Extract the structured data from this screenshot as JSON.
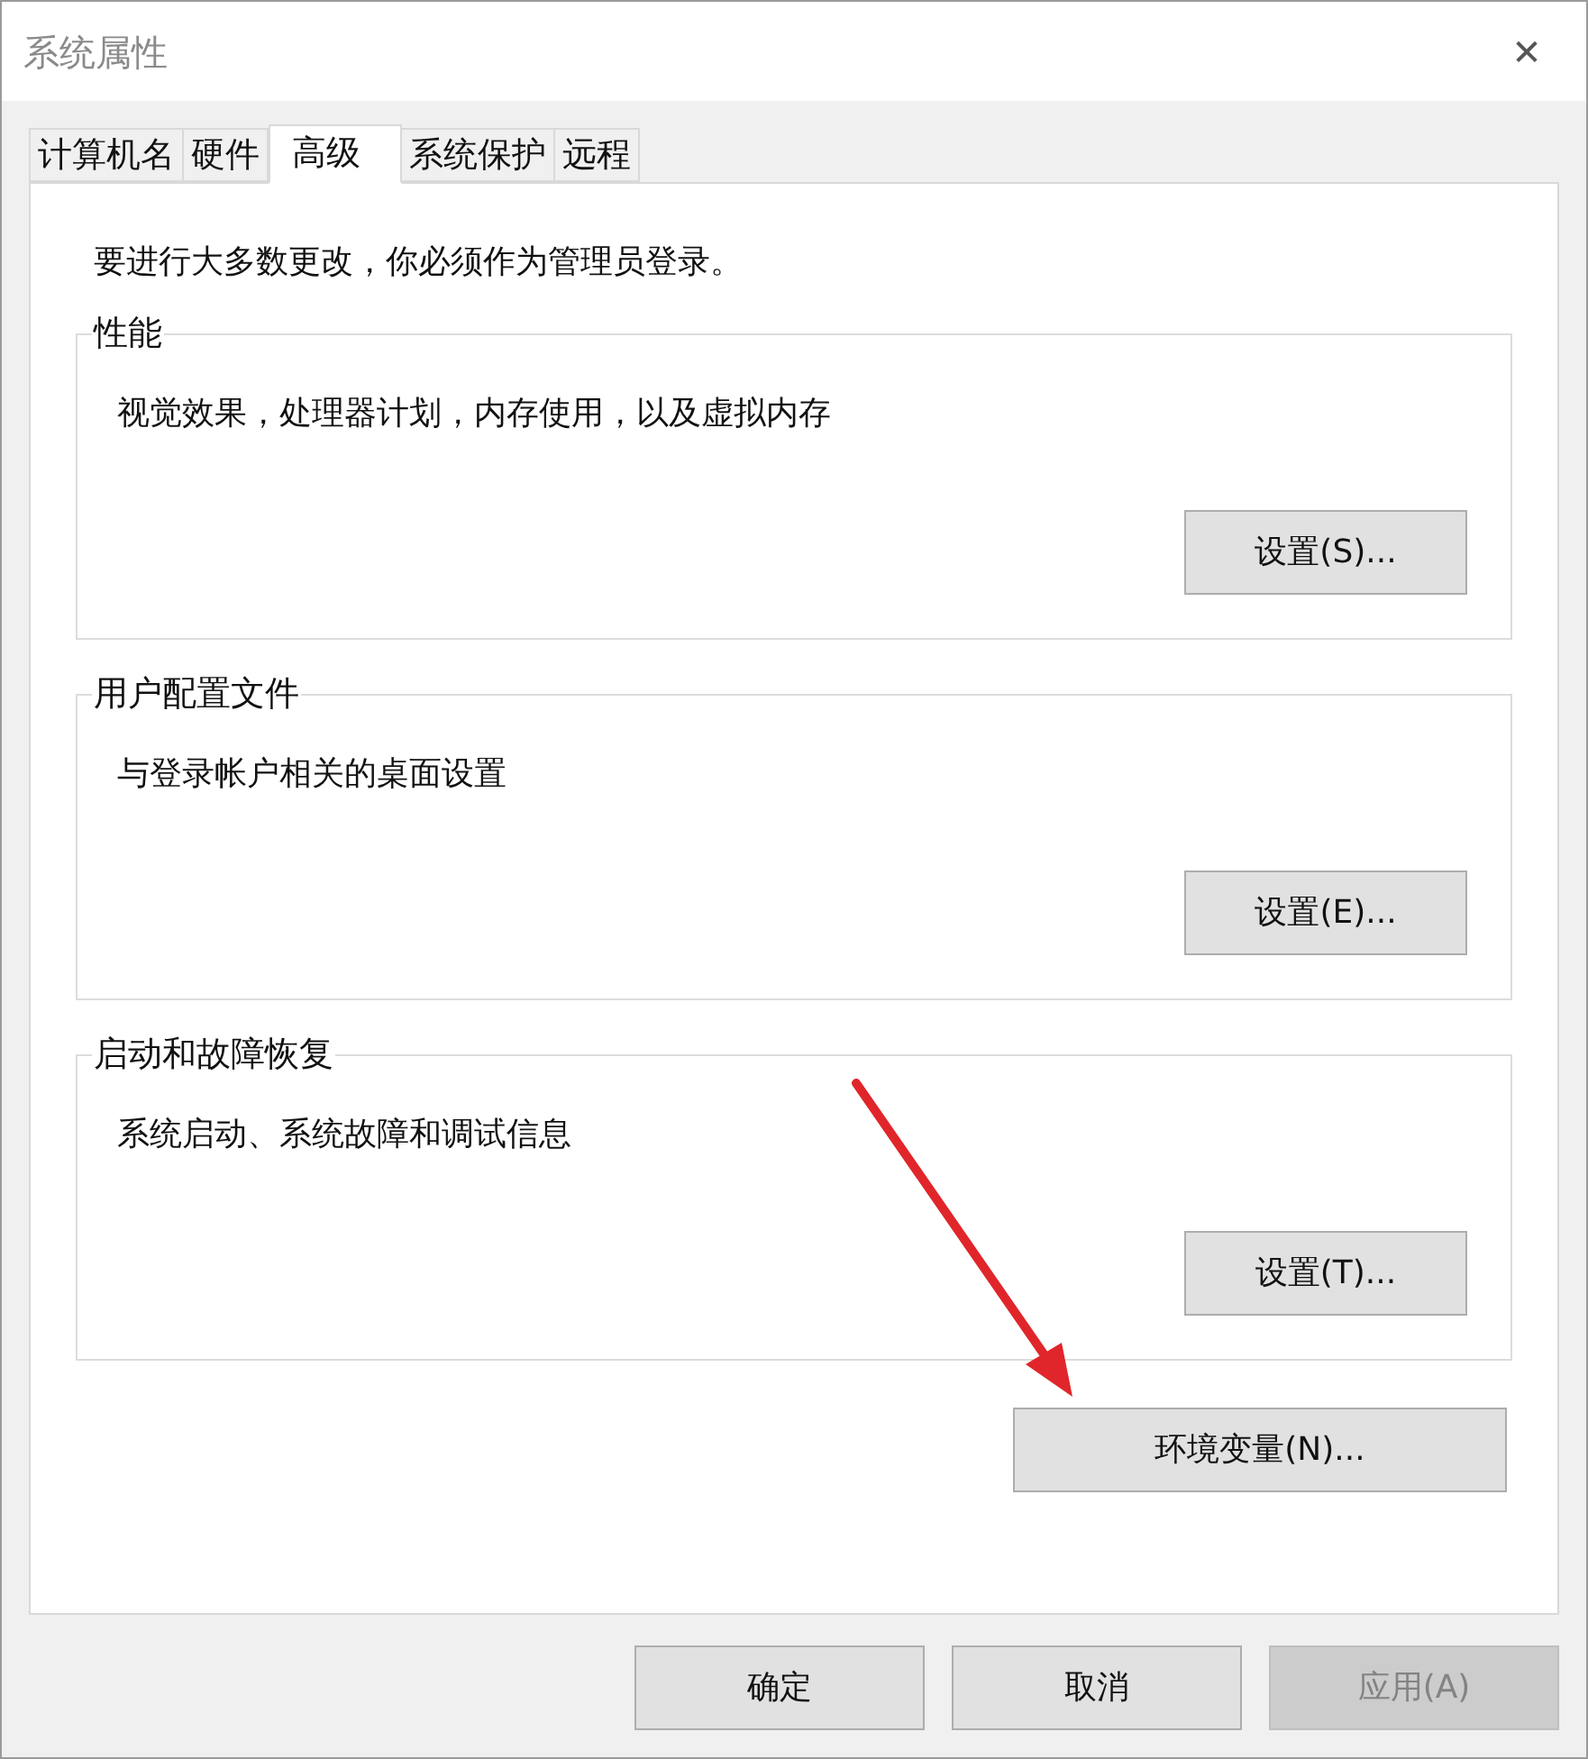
{
  "window": {
    "title": "系统属性",
    "close": "✕"
  },
  "tabs": [
    {
      "label": "计算机名",
      "selected": false
    },
    {
      "label": "硬件",
      "selected": false
    },
    {
      "label": "高级",
      "selected": true
    },
    {
      "label": "系统保护",
      "selected": false
    },
    {
      "label": "远程",
      "selected": false
    }
  ],
  "notice": "要进行大多数更改，你必须作为管理员登录。",
  "groups": [
    {
      "title": "性能",
      "description": "视觉效果，处理器计划，内存使用，以及虚拟内存",
      "button": "设置(S)..."
    },
    {
      "title": "用户配置文件",
      "description": "与登录帐户相关的桌面设置",
      "button": "设置(E)..."
    },
    {
      "title": "启动和故障恢复",
      "description": "系统启动、系统故障和调试信息",
      "button": "设置(T)..."
    }
  ],
  "env_button": "环境变量(N)...",
  "buttons": [
    {
      "label": "确定",
      "disabled": false
    },
    {
      "label": "取消",
      "disabled": false
    },
    {
      "label": "应用(A)",
      "disabled": true
    }
  ]
}
